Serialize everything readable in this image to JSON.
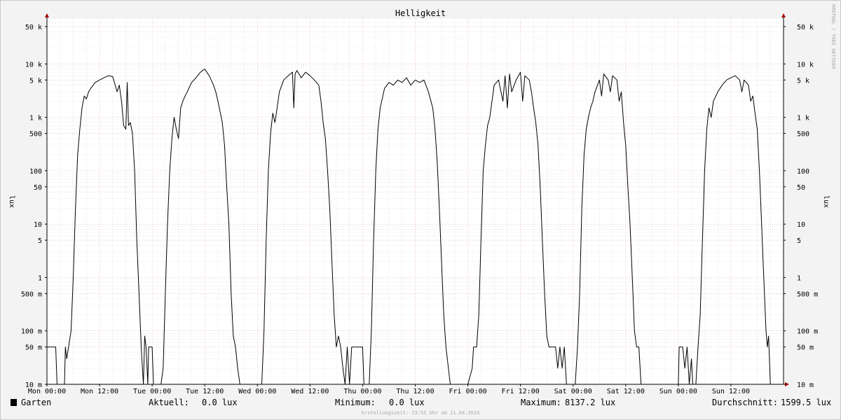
{
  "chart_data": {
    "type": "line",
    "title": "Helligkeit",
    "ylabel": "lux",
    "ylabel_right": "lux",
    "y_scale": "log",
    "ylim": [
      0.01,
      80000
    ],
    "xlim": [
      "Mon 00:00",
      "Mon 00:00 (next week)"
    ],
    "grid": true,
    "y_ticks": [
      {
        "value": 50000,
        "label": "50 k"
      },
      {
        "value": 10000,
        "label": "10 k"
      },
      {
        "value": 5000,
        "label": "5 k"
      },
      {
        "value": 1000,
        "label": "1 k"
      },
      {
        "value": 500,
        "label": "500"
      },
      {
        "value": 100,
        "label": "100"
      },
      {
        "value": 50,
        "label": "50"
      },
      {
        "value": 10,
        "label": "10"
      },
      {
        "value": 5,
        "label": "5"
      },
      {
        "value": 1,
        "label": "1"
      },
      {
        "value": 0.5,
        "label": "500 m"
      },
      {
        "value": 0.1,
        "label": "100 m"
      },
      {
        "value": 0.05,
        "label": "50 m"
      },
      {
        "value": 0.01,
        "label": "10 m"
      }
    ],
    "x_ticks": [
      {
        "hour": 0,
        "label": "Mon 00:00"
      },
      {
        "hour": 12,
        "label": "Mon 12:00"
      },
      {
        "hour": 24,
        "label": "Tue 00:00"
      },
      {
        "hour": 36,
        "label": "Tue 12:00"
      },
      {
        "hour": 48,
        "label": "Wed 00:00"
      },
      {
        "hour": 60,
        "label": "Wed 12:00"
      },
      {
        "hour": 72,
        "label": "Thu 00:00"
      },
      {
        "hour": 84,
        "label": "Thu 12:00"
      },
      {
        "hour": 96,
        "label": "Fri 00:00"
      },
      {
        "hour": 108,
        "label": "Fri 12:00"
      },
      {
        "hour": 120,
        "label": "Sat 00:00"
      },
      {
        "hour": 132,
        "label": "Sat 12:00"
      },
      {
        "hour": 144,
        "label": "Sun 00:00"
      },
      {
        "hour": 156,
        "label": "Sun 12:00"
      }
    ],
    "series": [
      {
        "name": "Garten",
        "color": "#000000",
        "points": [
          [
            0,
            0.05
          ],
          [
            2,
            0.05
          ],
          [
            2.3,
            0.01
          ],
          [
            4,
            0.01
          ],
          [
            4.2,
            0.05
          ],
          [
            4.5,
            0.03
          ],
          [
            5.5,
            0.1
          ],
          [
            6,
            1
          ],
          [
            6.5,
            20
          ],
          [
            7,
            200
          ],
          [
            7.5,
            600
          ],
          [
            8,
            1500
          ],
          [
            8.5,
            2500
          ],
          [
            9,
            2200
          ],
          [
            9.5,
            3000
          ],
          [
            10,
            3500
          ],
          [
            11,
            4500
          ],
          [
            12,
            5000
          ],
          [
            13,
            5500
          ],
          [
            14,
            6000
          ],
          [
            15,
            5800
          ],
          [
            16,
            3000
          ],
          [
            16.5,
            4000
          ],
          [
            17,
            2000
          ],
          [
            17.5,
            700
          ],
          [
            18,
            600
          ],
          [
            18.3,
            4500
          ],
          [
            18.6,
            700
          ],
          [
            19,
            800
          ],
          [
            19.5,
            500
          ],
          [
            20,
            100
          ],
          [
            20.5,
            5
          ],
          [
            21,
            0.5
          ],
          [
            21.5,
            0.05
          ],
          [
            22,
            0.01
          ],
          [
            22.3,
            0.08
          ],
          [
            22.6,
            0.05
          ],
          [
            23,
            0.01
          ],
          [
            23.2,
            0.05
          ],
          [
            24,
            0.05
          ],
          [
            24.3,
            0.01
          ],
          [
            26,
            0.01
          ],
          [
            26.5,
            0.02
          ],
          [
            27,
            0.5
          ],
          [
            27.5,
            10
          ],
          [
            28,
            100
          ],
          [
            28.5,
            400
          ],
          [
            29,
            1000
          ],
          [
            29.5,
            600
          ],
          [
            30,
            400
          ],
          [
            30.5,
            1500
          ],
          [
            31,
            2000
          ],
          [
            31.5,
            2500
          ],
          [
            32,
            3000
          ],
          [
            33,
            4500
          ],
          [
            34,
            5500
          ],
          [
            35,
            7000
          ],
          [
            36,
            8000
          ],
          [
            37,
            6000
          ],
          [
            38,
            4000
          ],
          [
            38.5,
            3000
          ],
          [
            39,
            2000
          ],
          [
            40,
            800
          ],
          [
            40.5,
            300
          ],
          [
            41,
            50
          ],
          [
            41.5,
            10
          ],
          [
            42,
            0.5
          ],
          [
            42.5,
            0.08
          ],
          [
            43,
            0.05
          ],
          [
            43.5,
            0.02
          ],
          [
            44,
            0.01
          ],
          [
            48,
            0.01
          ],
          [
            49,
            0.01
          ],
          [
            49.5,
            0.1
          ],
          [
            50,
            5
          ],
          [
            50.5,
            100
          ],
          [
            51,
            500
          ],
          [
            51.5,
            1200
          ],
          [
            52,
            800
          ],
          [
            52.5,
            1500
          ],
          [
            53,
            3000
          ],
          [
            54,
            5000
          ],
          [
            55,
            6000
          ],
          [
            56,
            7000
          ],
          [
            56.3,
            1500
          ],
          [
            56.6,
            6500
          ],
          [
            57,
            7500
          ],
          [
            58,
            5500
          ],
          [
            59,
            7000
          ],
          [
            60,
            6000
          ],
          [
            61,
            5000
          ],
          [
            62,
            4000
          ],
          [
            62.5,
            2000
          ],
          [
            63,
            800
          ],
          [
            63.5,
            400
          ],
          [
            64,
            100
          ],
          [
            64.5,
            20
          ],
          [
            65,
            2
          ],
          [
            65.5,
            0.2
          ],
          [
            66,
            0.05
          ],
          [
            66.5,
            0.08
          ],
          [
            67,
            0.05
          ],
          [
            67.5,
            0.02
          ],
          [
            68,
            0.01
          ],
          [
            68.5,
            0.05
          ],
          [
            69,
            0.01
          ],
          [
            69.5,
            0.05
          ],
          [
            72,
            0.05
          ],
          [
            72.3,
            0.01
          ],
          [
            73.5,
            0.01
          ],
          [
            74,
            0.1
          ],
          [
            74.5,
            5
          ],
          [
            75,
            100
          ],
          [
            75.5,
            600
          ],
          [
            76,
            1500
          ],
          [
            77,
            3500
          ],
          [
            78,
            4500
          ],
          [
            79,
            4000
          ],
          [
            80,
            5000
          ],
          [
            81,
            4500
          ],
          [
            82,
            5500
          ],
          [
            83,
            4000
          ],
          [
            84,
            5000
          ],
          [
            85,
            4500
          ],
          [
            86,
            5000
          ],
          [
            87,
            3000
          ],
          [
            88,
            1500
          ],
          [
            88.5,
            600
          ],
          [
            89,
            150
          ],
          [
            89.5,
            20
          ],
          [
            90,
            2
          ],
          [
            90.5,
            0.2
          ],
          [
            91,
            0.05
          ],
          [
            92,
            0.01
          ],
          [
            96,
            0.01
          ],
          [
            97,
            0.02
          ],
          [
            97.3,
            0.05
          ],
          [
            98,
            0.05
          ],
          [
            98.5,
            0.2
          ],
          [
            99,
            5
          ],
          [
            99.5,
            100
          ],
          [
            100,
            300
          ],
          [
            100.5,
            700
          ],
          [
            101,
            1000
          ],
          [
            101.5,
            2000
          ],
          [
            102,
            4000
          ],
          [
            103,
            5000
          ],
          [
            104,
            2000
          ],
          [
            104.5,
            6000
          ],
          [
            105,
            1500
          ],
          [
            105.5,
            6500
          ],
          [
            106,
            3000
          ],
          [
            107,
            5000
          ],
          [
            108,
            7000
          ],
          [
            108.5,
            2000
          ],
          [
            109,
            6000
          ],
          [
            110,
            5000
          ],
          [
            110.5,
            3000
          ],
          [
            111,
            1500
          ],
          [
            111.5,
            800
          ],
          [
            112,
            300
          ],
          [
            112.5,
            50
          ],
          [
            113,
            5
          ],
          [
            113.5,
            0.5
          ],
          [
            114,
            0.08
          ],
          [
            114.5,
            0.05
          ],
          [
            116,
            0.05
          ],
          [
            116.5,
            0.02
          ],
          [
            117,
            0.05
          ],
          [
            117.5,
            0.02
          ],
          [
            118,
            0.05
          ],
          [
            118.5,
            0.01
          ],
          [
            120,
            0.01
          ],
          [
            120.5,
            0.01
          ],
          [
            121,
            0.05
          ],
          [
            121.5,
            0.5
          ],
          [
            122,
            20
          ],
          [
            122.5,
            200
          ],
          [
            123,
            600
          ],
          [
            123.5,
            1000
          ],
          [
            124,
            1500
          ],
          [
            124.5,
            2000
          ],
          [
            125,
            3000
          ],
          [
            126,
            5000
          ],
          [
            126.5,
            2500
          ],
          [
            127,
            6500
          ],
          [
            128,
            5000
          ],
          [
            128.5,
            3000
          ],
          [
            129,
            6000
          ],
          [
            130,
            5000
          ],
          [
            130.5,
            2000
          ],
          [
            131,
            3000
          ],
          [
            131.5,
            800
          ],
          [
            132,
            300
          ],
          [
            132.5,
            50
          ],
          [
            133,
            10
          ],
          [
            133.5,
            1
          ],
          [
            134,
            0.1
          ],
          [
            134.5,
            0.05
          ],
          [
            135,
            0.05
          ],
          [
            135.5,
            0.01
          ],
          [
            144,
            0.01
          ],
          [
            144.2,
            0.05
          ],
          [
            145,
            0.05
          ],
          [
            145.5,
            0.02
          ],
          [
            146,
            0.05
          ],
          [
            146.5,
            0.01
          ],
          [
            147,
            0.03
          ],
          [
            147.3,
            0.01
          ],
          [
            148,
            0.01
          ],
          [
            148.5,
            0.05
          ],
          [
            149,
            0.2
          ],
          [
            149.5,
            5
          ],
          [
            150,
            100
          ],
          [
            150.5,
            600
          ],
          [
            151,
            1500
          ],
          [
            151.5,
            1000
          ],
          [
            152,
            2000
          ],
          [
            153,
            3000
          ],
          [
            154,
            4000
          ],
          [
            155,
            5000
          ],
          [
            156,
            5500
          ],
          [
            157,
            6000
          ],
          [
            158,
            5000
          ],
          [
            158.5,
            3000
          ],
          [
            159,
            5000
          ],
          [
            160,
            4000
          ],
          [
            160.5,
            2000
          ],
          [
            161,
            2500
          ],
          [
            161.5,
            1200
          ],
          [
            162,
            600
          ],
          [
            162.5,
            100
          ],
          [
            163,
            10
          ],
          [
            163.5,
            1
          ],
          [
            164,
            0.1
          ],
          [
            164.3,
            0.05
          ],
          [
            164.6,
            0.08
          ],
          [
            165,
            0.01
          ],
          [
            168,
            0.01
          ]
        ]
      }
    ],
    "legend": {
      "series_name": "Garten",
      "aktuell_label": "Aktuell:",
      "aktuell_value": "0.0 lux",
      "minimum_label": "Minimum:",
      "minimum_value": "0.0 lux",
      "maximum_label": "Maximum:",
      "maximum_value": "8137.2 lux",
      "avg_label": "Durchschnitt:",
      "avg_value": "1599.5 lux"
    },
    "footer": "Erstellungszeit: 23:55 Uhr am 21.04.2024",
    "watermark": "RRDTOOL / TOBI OETIKER",
    "colors": {
      "background": "#f3f3f3",
      "canvas": "#ffffff",
      "major_grid": "#e8a0a0",
      "minor_grid": "#cccccc",
      "line": "#000000",
      "arrow": "#a00000"
    }
  }
}
